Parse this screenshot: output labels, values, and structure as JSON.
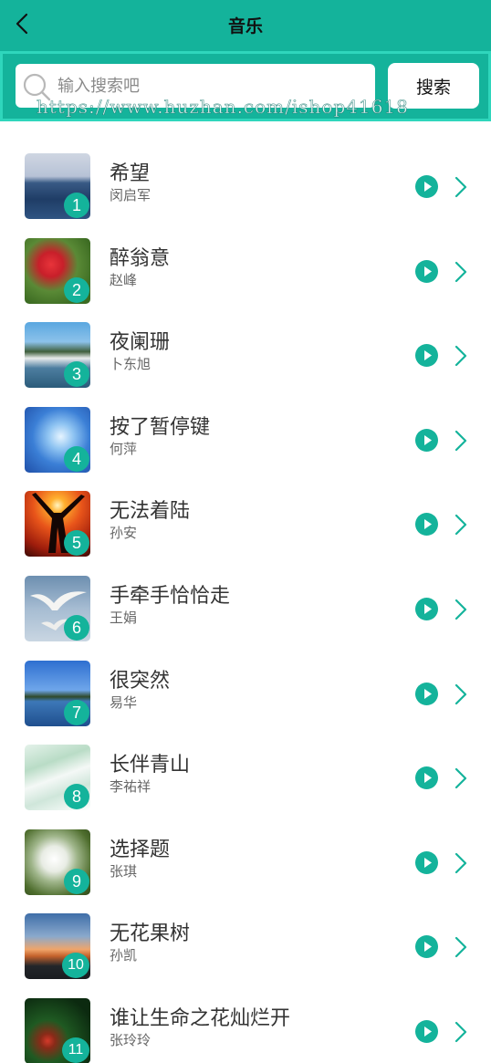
{
  "header": {
    "title": "音乐",
    "back_icon": "chevron-left-icon"
  },
  "search": {
    "placeholder": "输入搜索吧",
    "value": "",
    "button_label": "搜索",
    "watermark": "https://www.huzhan.com/ishop41618"
  },
  "colors": {
    "accent": "#14b39b",
    "accent_border": "#2fd6bc"
  },
  "songs": [
    {
      "rank": "1",
      "title": "希望",
      "artist": "闵启军"
    },
    {
      "rank": "2",
      "title": "醉翁意",
      "artist": "赵峰"
    },
    {
      "rank": "3",
      "title": "夜阑珊",
      "artist": "卜东旭"
    },
    {
      "rank": "4",
      "title": "按了暂停键",
      "artist": "何萍"
    },
    {
      "rank": "5",
      "title": "无法着陆",
      "artist": "孙安"
    },
    {
      "rank": "6",
      "title": "手牵手恰恰走",
      "artist": "王娟"
    },
    {
      "rank": "7",
      "title": "很突然",
      "artist": "易华"
    },
    {
      "rank": "8",
      "title": "长伴青山",
      "artist": "李祐祥"
    },
    {
      "rank": "9",
      "title": "选择题",
      "artist": "张琪"
    },
    {
      "rank": "10",
      "title": "无花果树",
      "artist": "孙凯"
    },
    {
      "rank": "11",
      "title": "谁让生命之花灿烂开",
      "artist": "张玲玲"
    }
  ]
}
